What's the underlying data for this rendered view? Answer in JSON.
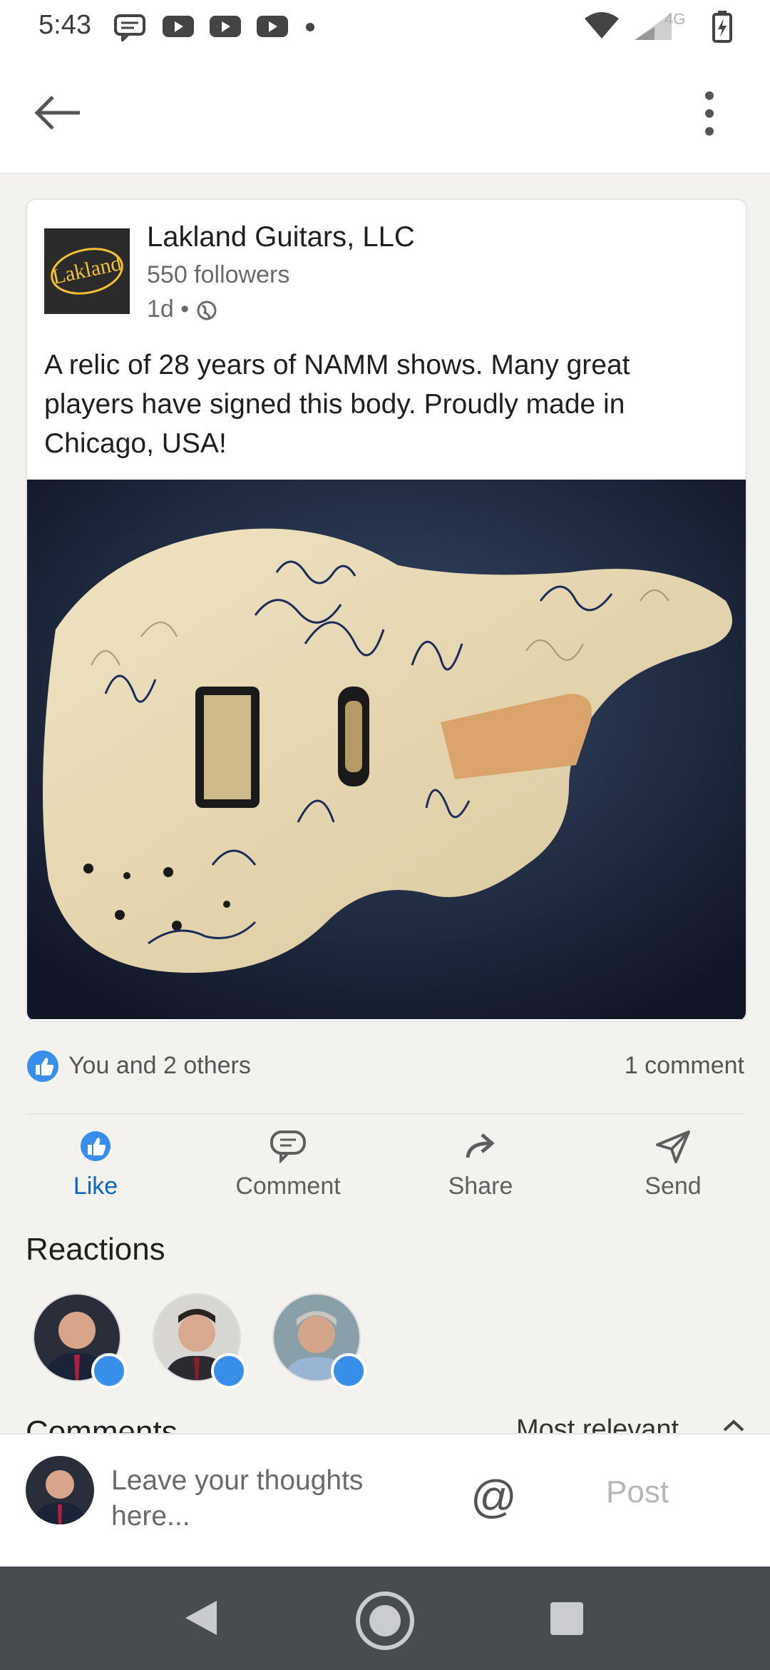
{
  "status_bar": {
    "time": "5:43",
    "network": "4G"
  },
  "post": {
    "company_name": "Lakland Guitars, LLC",
    "logo_text": "Lakland",
    "followers": "550 followers",
    "time_ago": "1d",
    "separator": "•",
    "text": "A relic of 28 years of NAMM shows. Many great players have signed this body. Proudly made in Chicago, USA!"
  },
  "social": {
    "reactions_text": "You and 2 others",
    "comments_text": "1 comment"
  },
  "actions": {
    "like": "Like",
    "comment": "Comment",
    "share": "Share",
    "send": "Send"
  },
  "reactions_heading": "Reactions",
  "comments_peek": {
    "heading": "Comments",
    "sort": "Most relevant"
  },
  "composer": {
    "placeholder": "Leave your thoughts here...",
    "mention": "@",
    "post_label": "Post"
  },
  "colors": {
    "accent": "#0a66c2",
    "like_blue": "#378fe9",
    "nav_bar": "#474b52",
    "logo_yellow": "#f2c230"
  }
}
